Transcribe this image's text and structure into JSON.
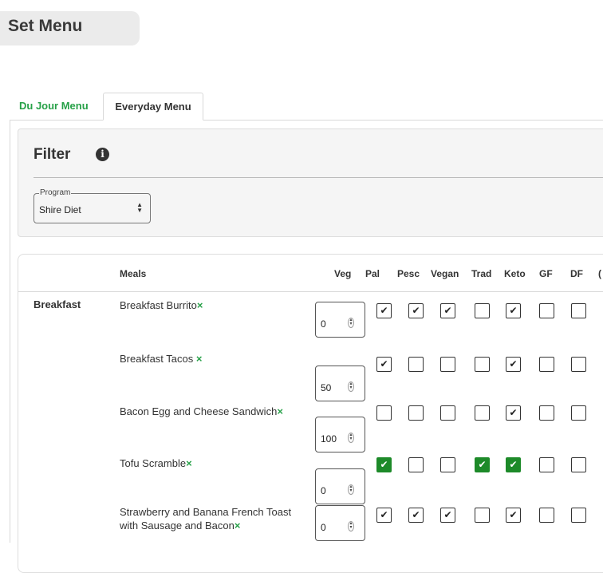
{
  "page": {
    "title": "Set Menu"
  },
  "tabs": [
    {
      "label": "Du Jour Menu",
      "active": false
    },
    {
      "label": "Everyday Menu",
      "active": true
    }
  ],
  "filter": {
    "title": "Filter",
    "info_icon": "info-circle-icon",
    "program": {
      "legend": "Program",
      "value": "Shire Diet"
    }
  },
  "table": {
    "headers": {
      "meals": "Meals",
      "veg": "Veg",
      "diets": [
        "Pal",
        "Pesc",
        "Vegan",
        "Trad",
        "Keto",
        "GF",
        "DF",
        "("
      ]
    },
    "section": "Breakfast",
    "remove_mark": "×",
    "rows": [
      {
        "name": "Breakfast Burrito",
        "veg": "0",
        "checks": [
          "checked",
          "checked",
          "checked",
          "",
          "checked",
          "",
          ""
        ]
      },
      {
        "name": "Breakfast Tacos ",
        "veg": "50",
        "checks": [
          "checked",
          "",
          "",
          "",
          "checked",
          "",
          ""
        ]
      },
      {
        "name": "Bacon Egg and Cheese Sandwich",
        "veg": "100",
        "checks": [
          "",
          "",
          "",
          "",
          "checked",
          "",
          ""
        ]
      },
      {
        "name": "Tofu Scramble",
        "veg": "0",
        "checks": [
          "green",
          "",
          "",
          "green",
          "green",
          "",
          ""
        ]
      },
      {
        "name": "Strawberry and Banana French Toast with Sausage and Bacon",
        "veg": "0",
        "checks": [
          "checked",
          "checked",
          "checked",
          "",
          "checked",
          "",
          ""
        ]
      }
    ]
  },
  "colors": {
    "accent_green": "#27a148",
    "checked_green": "#1d8a29"
  }
}
